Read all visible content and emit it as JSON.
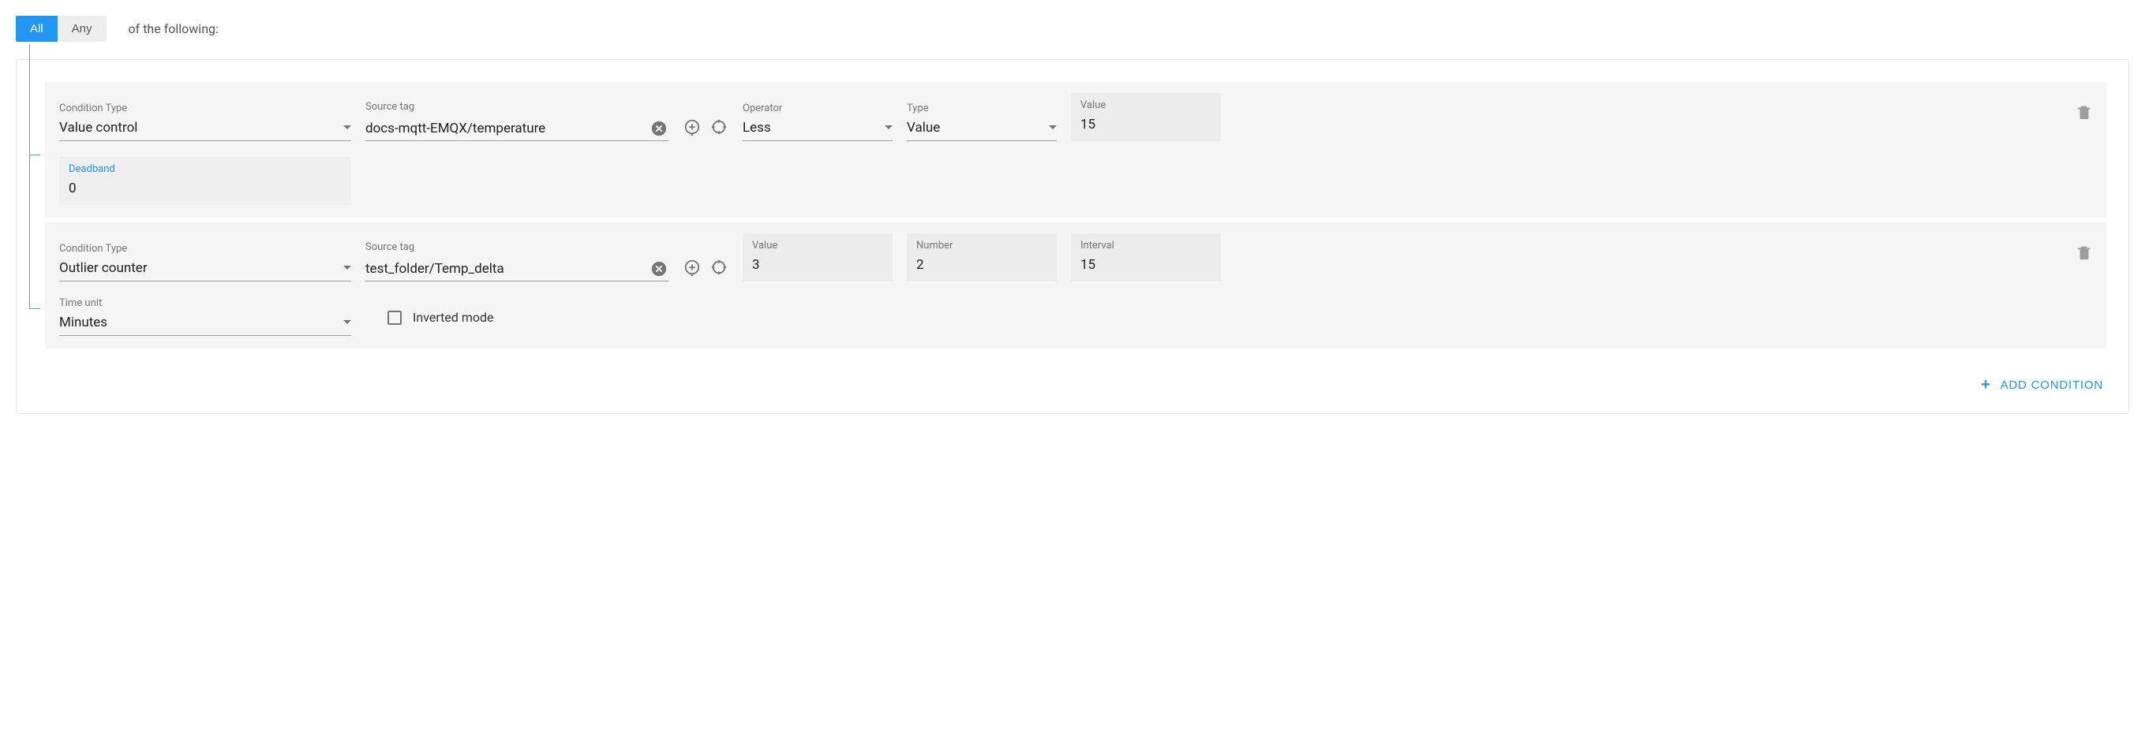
{
  "header": {
    "toggle_all": "All",
    "toggle_any": "Any",
    "text": "of the following:"
  },
  "conditions": [
    {
      "type_label": "Condition Type",
      "type_value": "Value control",
      "source_label": "Source tag",
      "source_value": "docs-mqtt-EMQX/temperature",
      "op_label": "Operator",
      "op_value": "Less",
      "vtype_label": "Type",
      "vtype_value": "Value",
      "value_label": "Value",
      "value_value": "15",
      "deadband_label": "Deadband",
      "deadband_value": "0"
    },
    {
      "type_label": "Condition Type",
      "type_value": "Outlier counter",
      "source_label": "Source tag",
      "source_value": "test_folder/Temp_delta",
      "value_label": "Value",
      "value_value": "3",
      "number_label": "Number",
      "number_value": "2",
      "interval_label": "Interval",
      "interval_value": "15",
      "timeunit_label": "Time unit",
      "timeunit_value": "Minutes",
      "inverted_label": "Inverted mode",
      "inverted_checked": false
    }
  ],
  "add_condition_label": "Add Condition",
  "icons": {
    "clear": "clear-icon",
    "add_tag": "add-target-icon",
    "target": "target-icon",
    "delete": "trash-icon"
  }
}
